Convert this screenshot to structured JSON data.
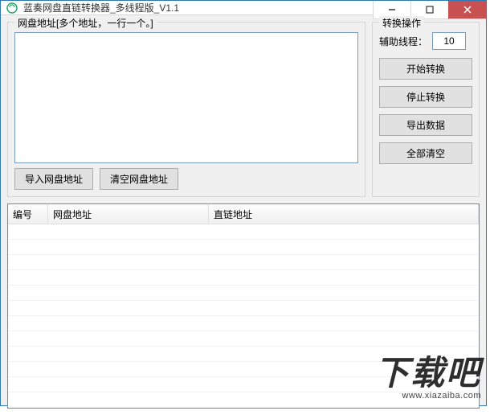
{
  "window": {
    "title": "蓝奏网盘直链转换器_多线程版_V1.1"
  },
  "addr_group": {
    "legend": "网盘地址[多个地址，一行一个。]",
    "textarea_value": "",
    "import_btn": "导入网盘地址",
    "clear_btn": "清空网盘地址"
  },
  "ops_group": {
    "legend": "转换操作",
    "thread_label": "辅助线程：",
    "thread_value": "10",
    "start_btn": "开始转换",
    "stop_btn": "停止转换",
    "export_btn": "导出数据",
    "clear_all_btn": "全部清空"
  },
  "list": {
    "columns": {
      "num": "编号",
      "pan": "网盘地址",
      "direct": "直链地址"
    },
    "rows": []
  },
  "watermark": {
    "big": "下载吧",
    "url": "www.xiazaiba.com"
  }
}
